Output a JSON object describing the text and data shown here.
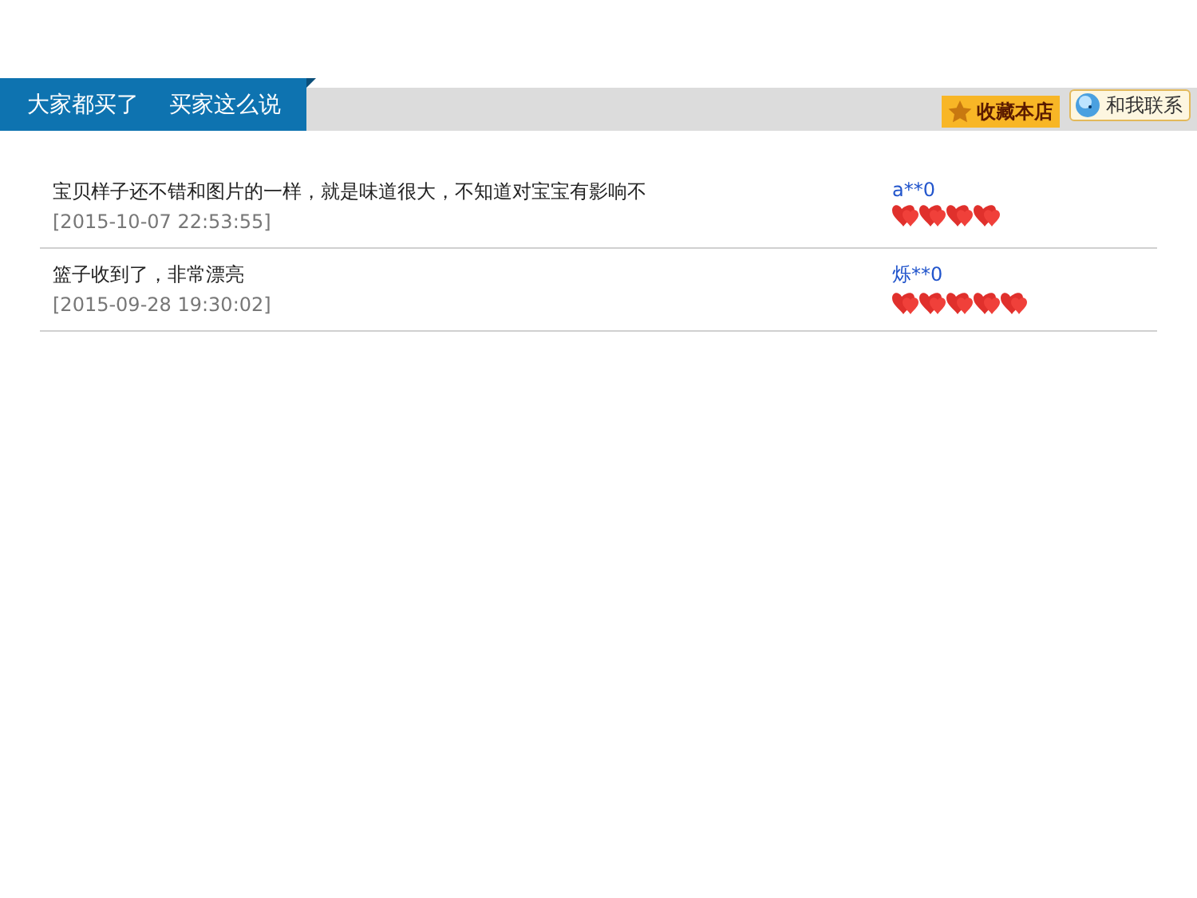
{
  "header": {
    "tabs": [
      {
        "label": "大家都买了",
        "selected": true
      },
      {
        "label": "买家这么说",
        "selected": true
      }
    ],
    "buttons": [
      {
        "kind": "favorite",
        "label": "收藏本店"
      },
      {
        "kind": "contact",
        "label": "和我联系"
      }
    ]
  },
  "reviews": [
    {
      "text": "宝贝样子还不错和图片的一样，就是味道很大，不知道对宝宝有影响不",
      "date": "[2015-10-07 22:53:55]",
      "user": "a**0",
      "stars": 4
    },
    {
      "text": "篮子收到了，非常漂亮",
      "date": "[2015-09-28 19:30:02]",
      "user": "烁**0",
      "stars": 5
    }
  ]
}
